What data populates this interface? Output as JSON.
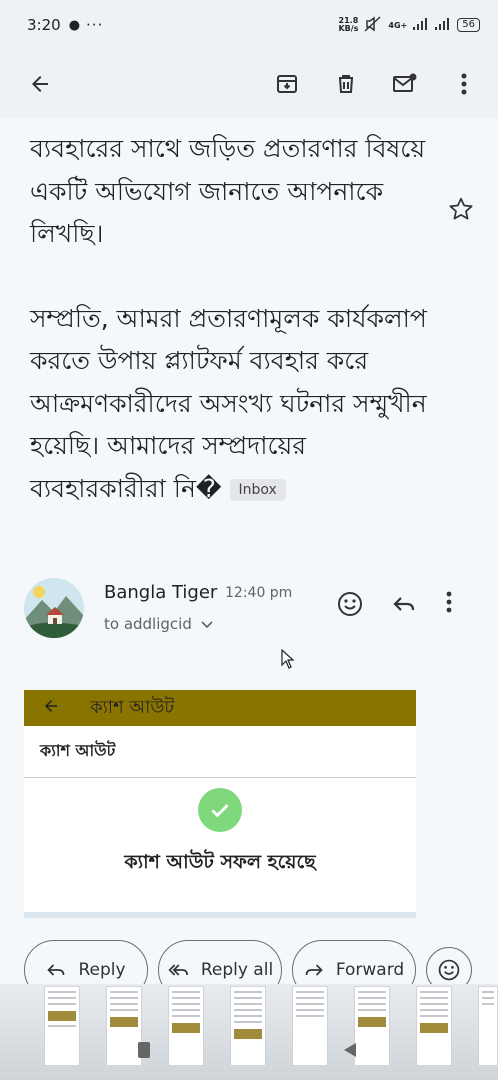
{
  "status_bar": {
    "time": "3:20",
    "more": "···",
    "speed_value": "21.8",
    "speed_unit": "KB/s",
    "network": "4G+",
    "battery": "56"
  },
  "email": {
    "paragraph1": "ব্যবহারের সাথে জড়িত প্রতারণার বিষয়ে একটি অভিযোগ জানাতে আপনাকে লিখছি।",
    "paragraph2": "সম্প্রতি, আমরা প্রতারণামূলক কার্যকলাপ করতে উপায় প্ল্যাটফর্ম ব্যবহার করে আক্রমণকারীদের অসংখ্য ঘটনার সম্মুখীন হয়েছি। আমাদের সম্প্রদায়ের ব্যবহারকারীরা নি�",
    "label": "Inbox",
    "sender_name": "Bangla Tiger",
    "time": "12:40 pm",
    "recipient": "to addligcid"
  },
  "attachment": {
    "topbar_title": "ক্যাশ আউট",
    "header_title": "ক্যাশ আউট",
    "success_text": "ক্যাশ আউট সফল হয়েছে"
  },
  "actions": {
    "reply": "Reply",
    "reply_all": "Reply all",
    "forward": "Forward"
  },
  "colors": {
    "accent_check": "#7fd97c",
    "attachment_bar": "#8a7400"
  }
}
